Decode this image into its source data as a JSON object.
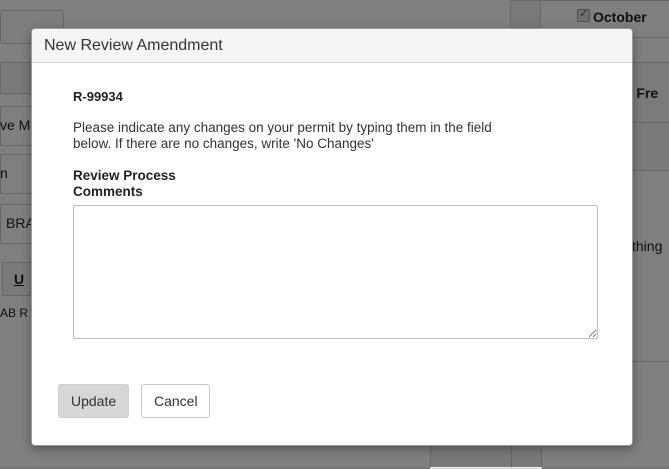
{
  "background": {
    "top_right_checkbox_label": "October",
    "fragments": {
      "left_1": "ve M",
      "left_2": "n",
      "left_3": "BRA",
      "left_4": "U",
      "left_5": "AB R",
      "right_1": "m Fre",
      "right_2": "thing"
    }
  },
  "modal": {
    "title": "New Review Amendment",
    "record_id": "R-99934",
    "instructions": "Please indicate any changes on your permit by typing them in the field below. If there are no changes, write 'No Changes'",
    "field_label": "Review Process Comments",
    "comments_value": "",
    "buttons": {
      "update": "Update",
      "cancel": "Cancel"
    }
  },
  "colors": {
    "overlay": "#000000",
    "modal_header_bg": "#f5f5f5",
    "update_button_bg": "#d7d7d7"
  }
}
